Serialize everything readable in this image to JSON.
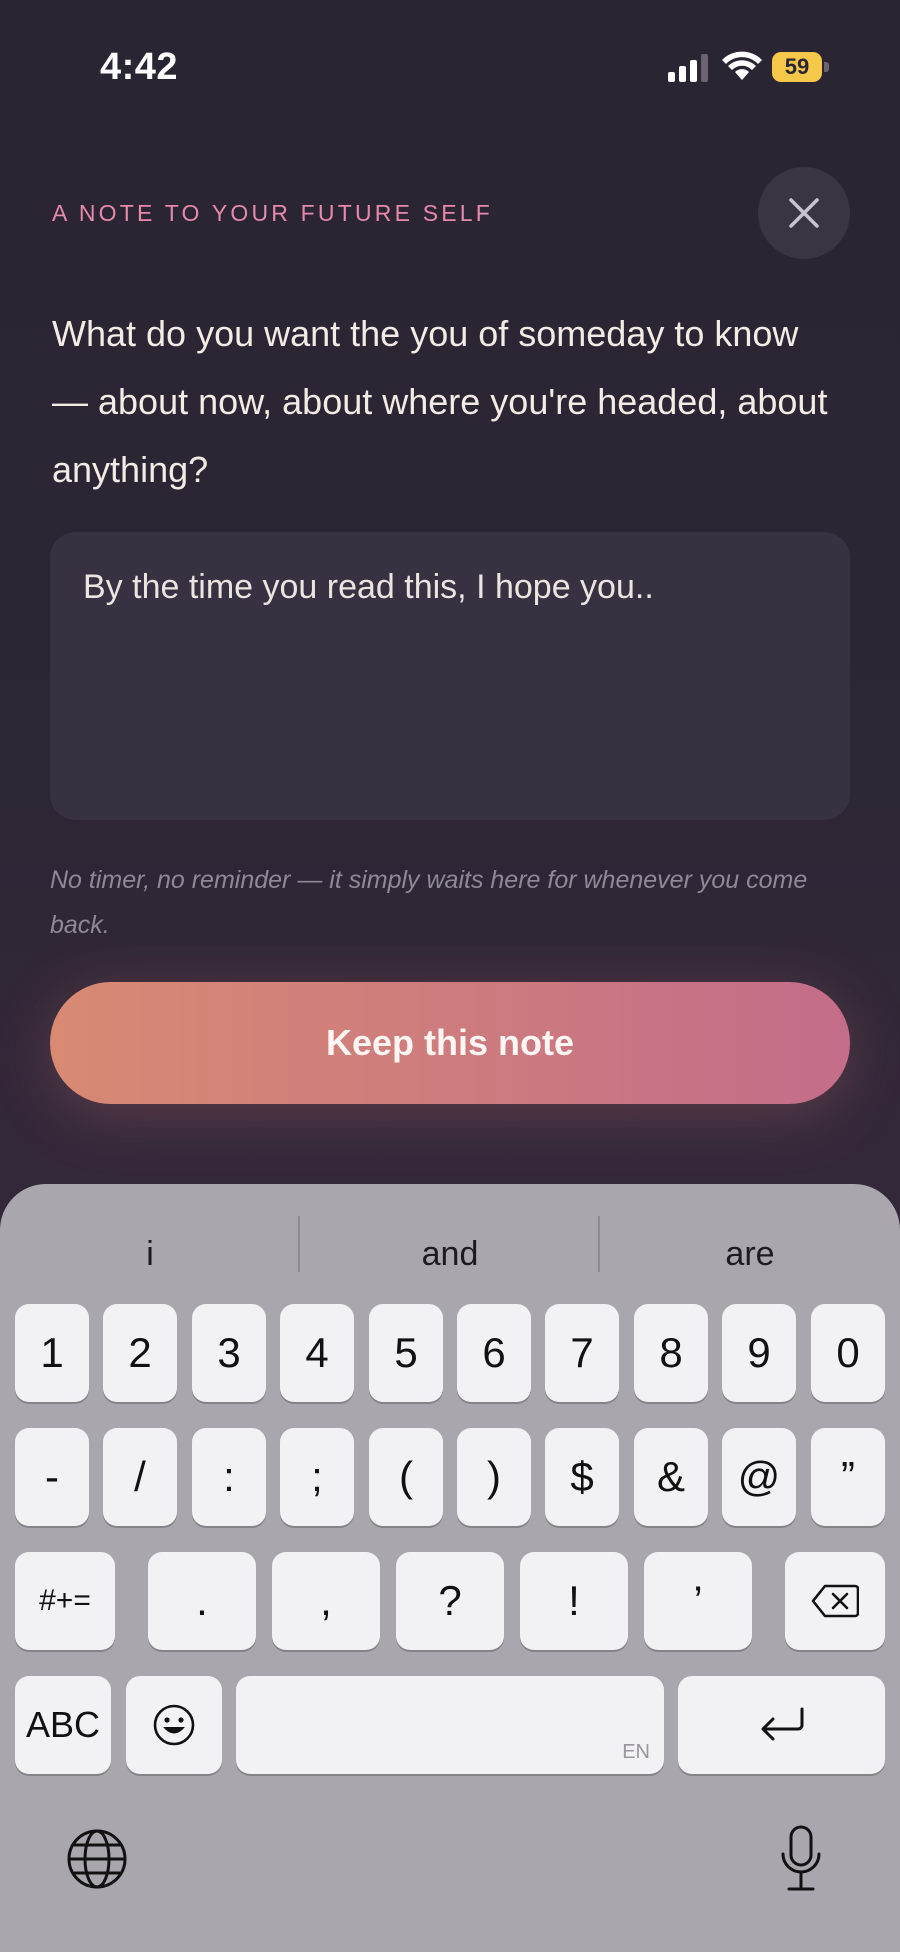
{
  "status_bar": {
    "time": "4:42",
    "battery": "59",
    "icons": [
      "signal-icon",
      "wifi-icon",
      "battery-icon"
    ]
  },
  "header": {
    "eyebrow": "A NOTE TO YOUR FUTURE SELF",
    "close_icon": "close-icon"
  },
  "prompt": "What do you want the you of someday to know — about now, about where you're headed, about anything?",
  "note": {
    "value": "By the time you read this, I hope you.."
  },
  "hint": "No timer, no reminder — it simply waits here for whenever you come back.",
  "cta": {
    "label": "Keep this note"
  },
  "keyboard": {
    "suggestions": [
      "i",
      "and",
      "are"
    ],
    "row1": [
      "1",
      "2",
      "3",
      "4",
      "5",
      "6",
      "7",
      "8",
      "9",
      "0"
    ],
    "row2": [
      "-",
      "/",
      ":",
      ";",
      "(",
      ")",
      "$",
      "&",
      "@",
      "”"
    ],
    "row3": [
      "#+=",
      ".",
      ",",
      "?",
      "!",
      "’"
    ],
    "abc": "ABC",
    "space_lang": "EN",
    "icons": [
      "backspace-icon",
      "emoji-icon",
      "return-icon",
      "globe-icon",
      "microphone-icon"
    ]
  },
  "colors": {
    "accent": "#e58aa8",
    "cta_start": "#d88a73",
    "cta_end": "#c46d8a",
    "background": "#2a2533",
    "battery": "#f6c84a"
  }
}
